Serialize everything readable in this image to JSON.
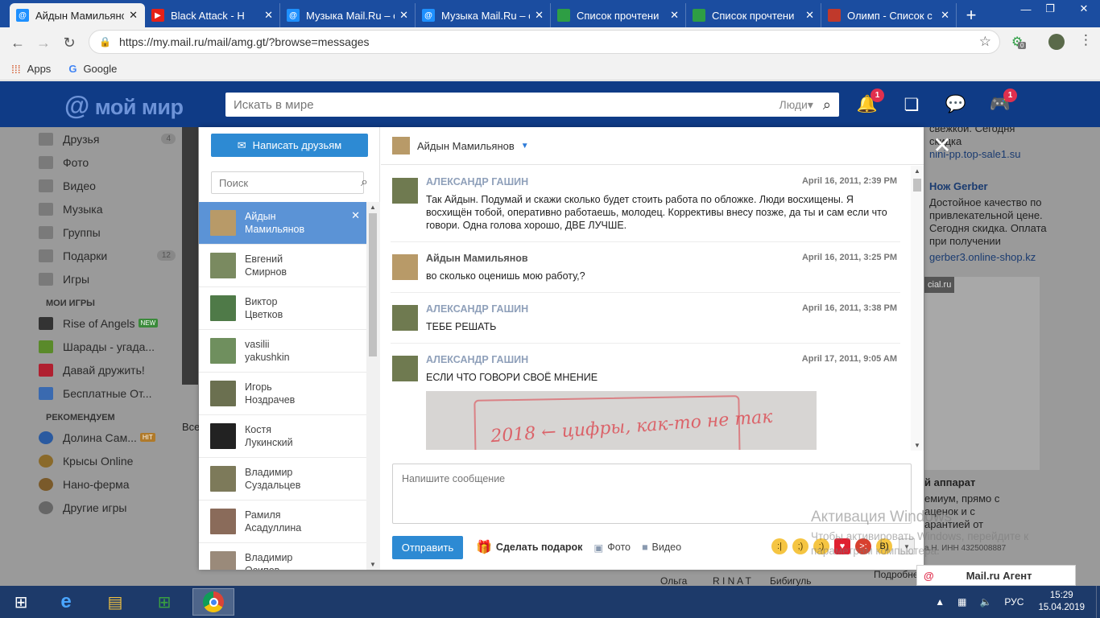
{
  "browser": {
    "tabs": [
      {
        "label": "Айдын Мамильянс",
        "favcolor": "#1e90ff",
        "favtext": "@",
        "active": true
      },
      {
        "label": "Black Attack - Н",
        "favcolor": "#e62117",
        "favtext": "▶",
        "active": false
      },
      {
        "label": "Музыка Mail.Ru – с",
        "favcolor": "#1e90ff",
        "favtext": "@",
        "active": false
      },
      {
        "label": "Музыка Mail.Ru – с",
        "favcolor": "#1e90ff",
        "favtext": "@",
        "active": false
      },
      {
        "label": "Список прочтени",
        "favcolor": "#2e9e44",
        "favtext": "",
        "active": false
      },
      {
        "label": "Список прочтени",
        "favcolor": "#2e9e44",
        "favtext": "",
        "active": false
      },
      {
        "label": "Олимп - Список с",
        "favcolor": "#c0392b",
        "favtext": "",
        "active": false
      }
    ],
    "url": "https://my.mail.ru/mail/amg.gt/?browse=messages",
    "bookmarks": [
      {
        "label": "Apps",
        "icon": "apps-grid-icon"
      },
      {
        "label": "Google",
        "icon": "google-g-icon"
      }
    ],
    "extension_badge": "0"
  },
  "site": {
    "logo": "мой мир",
    "search_placeholder": "Искать в мире",
    "search_scope": "Люди",
    "notifications_badge": "1",
    "games_badge": "1"
  },
  "background_left": {
    "menu": [
      {
        "label": "Друзья",
        "count": "4"
      },
      {
        "label": "Фото",
        "count": ""
      },
      {
        "label": "Видео",
        "count": ""
      },
      {
        "label": "Музыка",
        "count": ""
      },
      {
        "label": "Группы",
        "count": ""
      },
      {
        "label": "Подарки",
        "count": "12"
      },
      {
        "label": "Игры",
        "count": ""
      }
    ],
    "my_games_title": "МОИ ИГРЫ",
    "my_games": [
      {
        "label": "Rise of Angels",
        "tag": "NEW"
      },
      {
        "label": "Шарады - угада...",
        "tag": ""
      },
      {
        "label": "Давай дружить!",
        "tag": ""
      },
      {
        "label": "Бесплатные От...",
        "tag": ""
      }
    ],
    "recommended_title": "РЕКОМЕНДУЕМ",
    "recommended": [
      {
        "label": "Долина Сам...",
        "tag": "HIT"
      },
      {
        "label": "Крысы Online",
        "tag": ""
      },
      {
        "label": "Нано-ферма",
        "tag": ""
      },
      {
        "label": "Другие игры",
        "tag": ""
      }
    ],
    "all_label": "Все"
  },
  "background_right": {
    "ad1_text": "свежкой. Сегодня скидка",
    "ad1_link": "nini-pp.top-sale1.su",
    "ad2_title": "Нож Gerber",
    "ad2_text": "Достойное качество по привлекательной цене. Сегодня скидка. Оплата при получении",
    "ad2_link": "gerber3.online-shop.kz",
    "ad3_badge": "cial.ru",
    "ad3_title": "й аппарат",
    "ad3_text": "емиум, прямо с аценок и с арантией от",
    "ad3_footer": "а.Н. ИНН 4325008887",
    "bottom_names": [
      "Ольга",
      "R I N A T",
      "Бибигуль",
      "Подробне"
    ]
  },
  "chat": {
    "write_button": "Написать друзьям",
    "search_placeholder": "Поиск",
    "current_contact": "Айдын Мамильянов",
    "contacts": [
      {
        "name1": "Айдын",
        "name2": "Мамильянов",
        "active": true,
        "color": "#b89a68"
      },
      {
        "name1": "Евгений",
        "name2": "Смирнов",
        "active": false,
        "color": "#7a8a60"
      },
      {
        "name1": "Виктор",
        "name2": "Цветков",
        "active": false,
        "color": "#4f7a48"
      },
      {
        "name1": "vasilii",
        "name2": "yakushkin",
        "active": false,
        "color": "#6f8f5e"
      },
      {
        "name1": "Игорь",
        "name2": "Ноздрачев",
        "active": false,
        "color": "#6b7050"
      },
      {
        "name1": "Костя",
        "name2": "Лукинский",
        "active": false,
        "color": "#222222"
      },
      {
        "name1": "Владимир",
        "name2": "Суздальцев",
        "active": false,
        "color": "#7d7a5a"
      },
      {
        "name1": "Рамиля",
        "name2": "Асадуллина",
        "active": false,
        "color": "#8a6b5a"
      },
      {
        "name1": "Владимир",
        "name2": "Осипов",
        "active": false,
        "color": "#9a8a7a"
      }
    ],
    "messages": [
      {
        "author": "АЛЕКСАНДР ГАШИН",
        "self": false,
        "date": "April 16, 2011, 2:39 PM",
        "text": "Так Айдын. Подумай и скажи сколько будет стоить работа по обложке. Люди восхищены. Я восхищён тобой, оперативно работаешь, молодец. Коррективы внесу позже, да ты и сам если что говори. Одна голова хорошо, ДВЕ ЛУЧШЕ.",
        "has_photo": false
      },
      {
        "author": "Айдын Мамильянов",
        "self": true,
        "date": "April 16, 2011, 3:25 PM",
        "text": "во сколько оценишь мою работу,?",
        "has_photo": false
      },
      {
        "author": "АЛЕКСАНДР ГАШИН",
        "self": false,
        "date": "April 16, 2011, 3:38 PM",
        "text": "ТЕБЕ РЕШАТЬ",
        "has_photo": false
      },
      {
        "author": "АЛЕКСАНДР ГАШИН",
        "self": false,
        "date": "April 17, 2011, 9:05 AM",
        "text": "ЕСЛИ ЧТО ГОВОРИ СВОЁ МНЕНИЕ",
        "has_photo": true
      }
    ],
    "photo_text": "2018 ← цифры, как-то не так",
    "composer_placeholder": "Напишите сообщение",
    "send_button": "Отправить",
    "gift_label": "Сделать подарок",
    "photo_label": "Фото",
    "video_label": "Видео"
  },
  "watermark": {
    "title": "Активация Windows",
    "text": "Чтобы активировать Windows, перейдите к параметрам компьютера."
  },
  "agent": {
    "label": "Mail.ru Агент"
  },
  "taskbar": {
    "lang": "РУС",
    "time": "15:29",
    "date": "15.04.2019"
  }
}
